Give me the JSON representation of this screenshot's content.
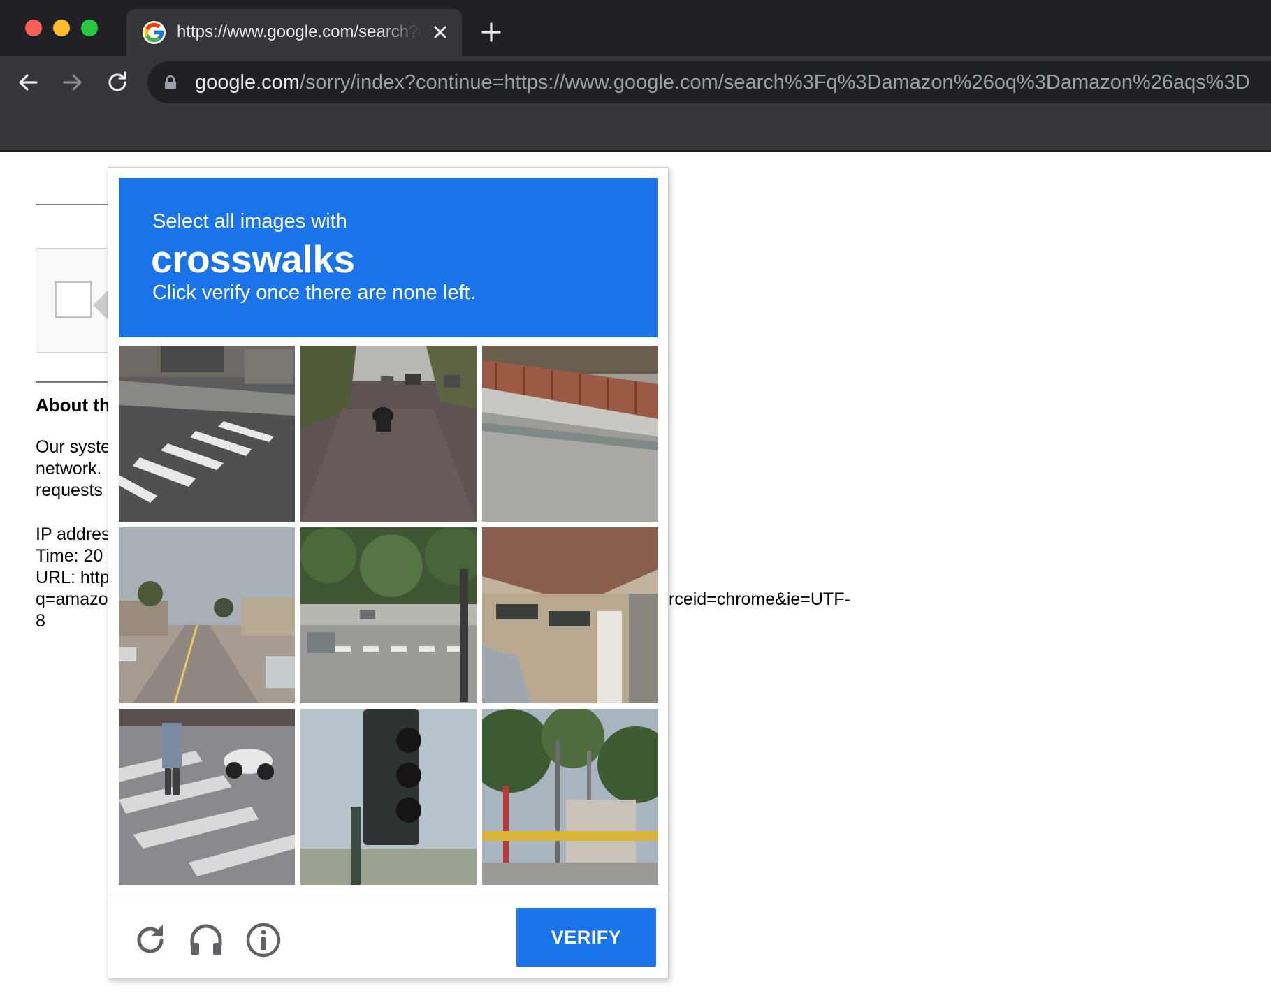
{
  "browser": {
    "tab_title": "https://www.google.com/search?q=amazon",
    "address_host": "google.com",
    "address_path": "/sorry/index?continue=https://www.google.com/search%3Fq%3Damazon%26oq%3Damazon%26aqs%3D",
    "icons": [
      "google-favicon",
      "close-icon",
      "plus-icon",
      "back-arrow-icon",
      "forward-arrow-icon",
      "reload-icon",
      "lock-icon"
    ]
  },
  "page": {
    "about_title": "About th",
    "para1": [
      "Our syste",
      "network.",
      "requests"
    ],
    "info_lines": [
      "IP addres",
      "Time: 20",
      "URL: http",
      "q=amazo",
      "8"
    ],
    "url_tail": "rceid=chrome&ie=UTF-"
  },
  "challenge": {
    "instruction_line1": "Select all images with",
    "target": "crosswalks",
    "instruction_line3": "Click verify once there are none left.",
    "header_color": "#1a73e8",
    "tiles": [
      "crosswalk-street-corner",
      "motorcycle-road",
      "sidewalk-red-railing",
      "residential-street-palms",
      "intersection-crosswalk",
      "house-garage-car",
      "pedestrian-crosswalk-scooter",
      "traffic-light",
      "street-signs-trees"
    ],
    "verify_label": "VERIFY",
    "footer_icons": [
      "reload-icon",
      "headphones-icon",
      "info-icon"
    ]
  }
}
